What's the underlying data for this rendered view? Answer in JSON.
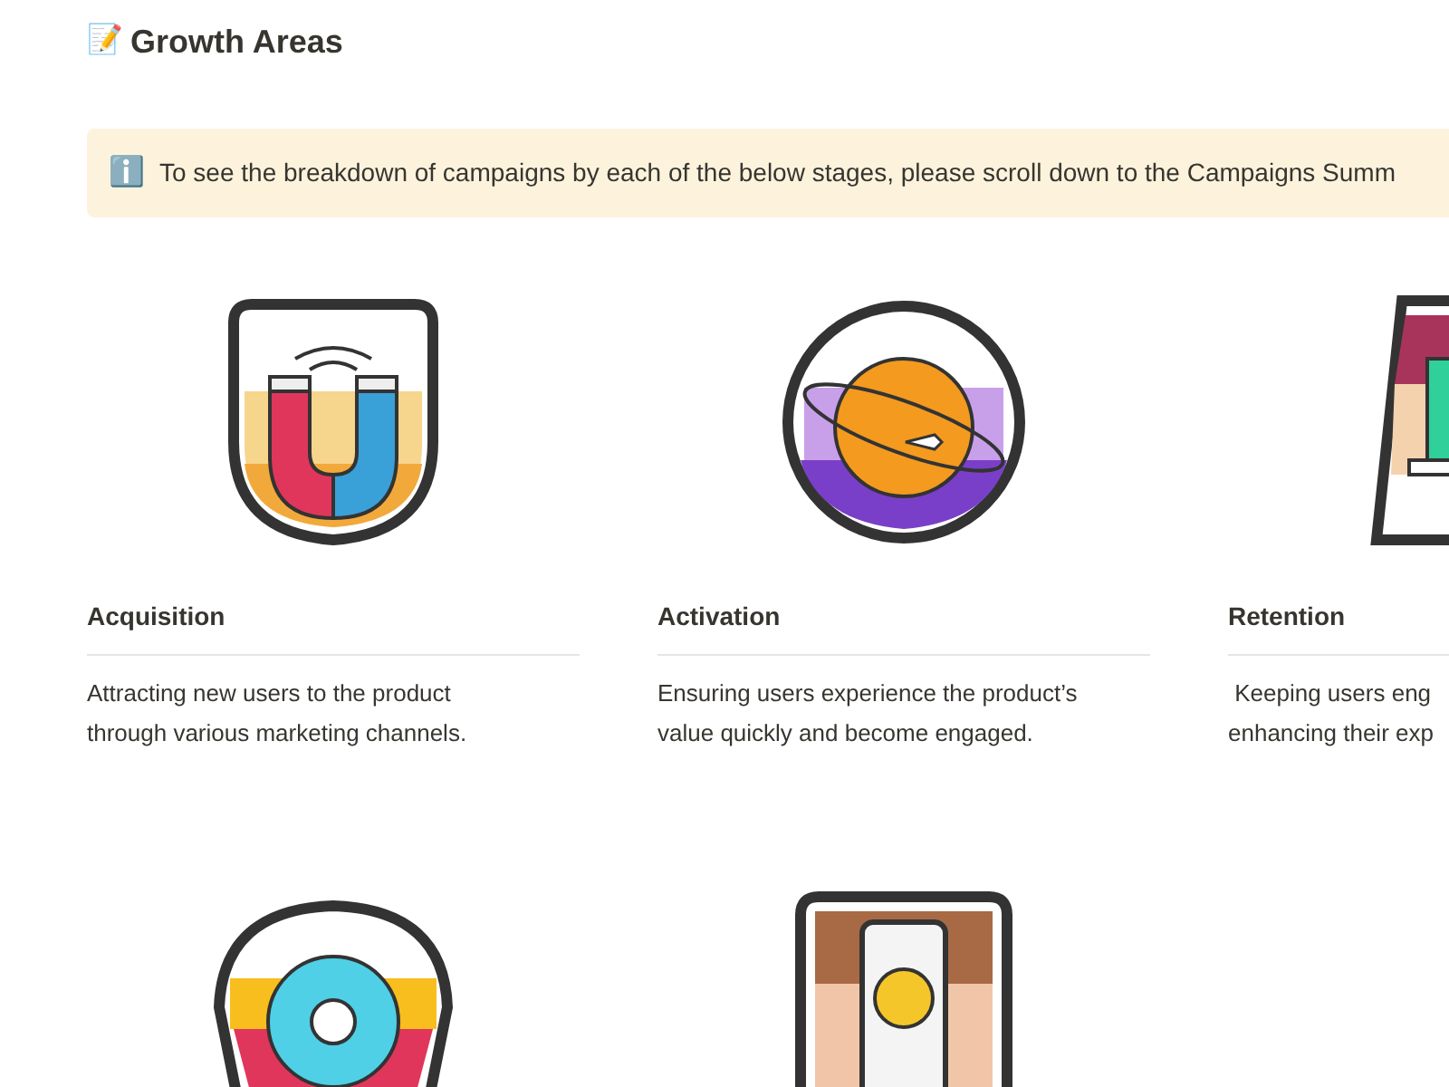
{
  "page": {
    "emoji": "📝",
    "title": "Growth Areas"
  },
  "callout": {
    "icon": "ℹ️",
    "text": "To see the breakdown of campaigns by each of the below stages, please scroll down to the Campaigns Summ"
  },
  "cards": [
    {
      "kind": "shield",
      "title": "Acquisition",
      "description_lines": [
        "Attracting new users to the product",
        "through various marketing channels."
      ]
    },
    {
      "kind": "circle",
      "title": "Activation",
      "description_lines": [
        "Ensuring users experience the product’s",
        "value quickly and become engaged."
      ]
    },
    {
      "kind": "trapezoid",
      "title": "Retention",
      "description_lines": [
        " Keeping users eng",
        "enhancing their exp"
      ]
    },
    {
      "kind": "pennant"
    },
    {
      "kind": "phone"
    }
  ]
}
